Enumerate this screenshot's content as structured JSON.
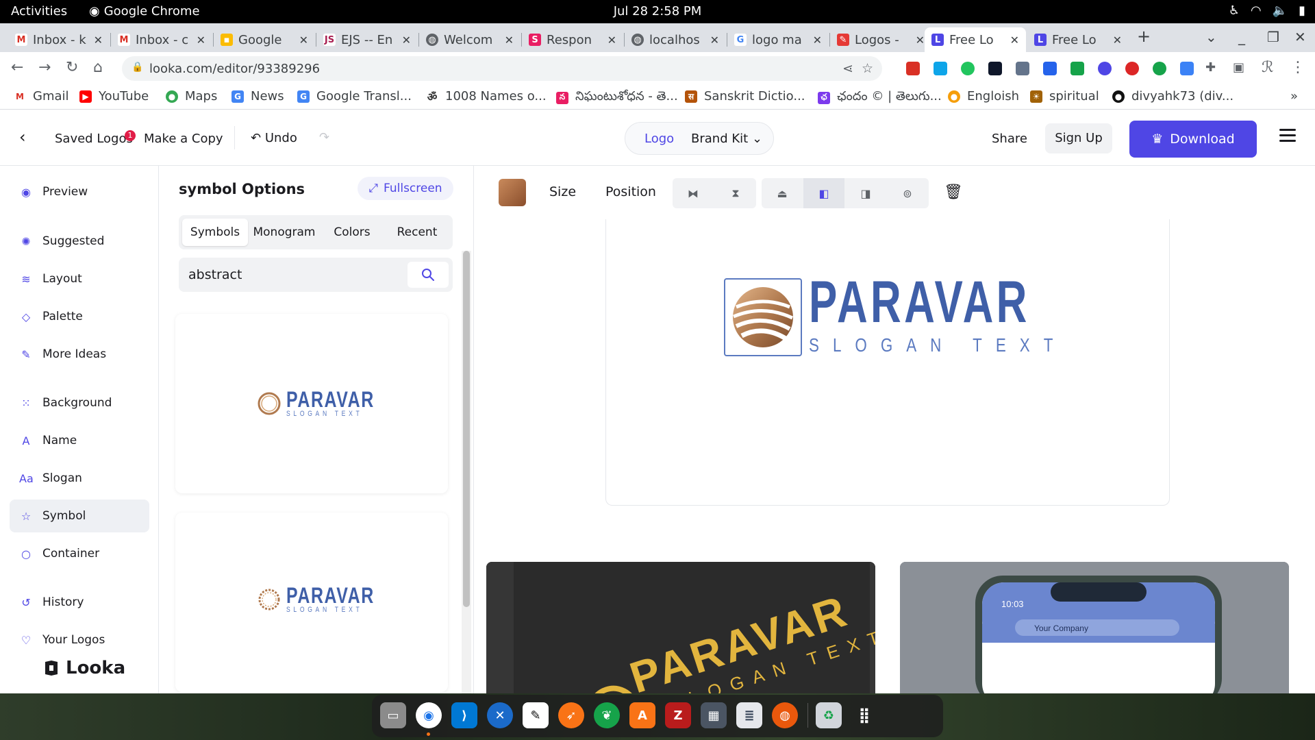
{
  "system_bar": {
    "activities": "Activities",
    "app_name": "Google Chrome",
    "clock": "Jul 28  2:58 PM"
  },
  "tabs": [
    {
      "label": "Inbox - k",
      "favicon": "gmail-icon",
      "color": "#d93025"
    },
    {
      "label": "Inbox - c",
      "favicon": "gmail-icon",
      "color": "#d93025"
    },
    {
      "label": "Google",
      "favicon": "google-keep-icon",
      "color": "#fbbc04"
    },
    {
      "label": "EJS -- En",
      "favicon": "ejs-icon",
      "color": "#a91e50"
    },
    {
      "label": "Welcom",
      "favicon": "globe-icon",
      "color": "#5f6368"
    },
    {
      "label": "Respon",
      "favicon": "responsive-icon",
      "color": "#e91e63"
    },
    {
      "label": "localhos",
      "favicon": "globe-icon",
      "color": "#5f6368"
    },
    {
      "label": "logo ma",
      "favicon": "google-icon",
      "color": "#4285f4"
    },
    {
      "label": "Logos -",
      "favicon": "logos-icon",
      "color": "#e53935"
    },
    {
      "label": "Free Lo",
      "favicon": "looka-icon",
      "color": "#4f46e5"
    },
    {
      "label": "Free Lo",
      "favicon": "looka-icon",
      "color": "#4f46e5"
    }
  ],
  "address": {
    "url": "looka.com/editor/93389296"
  },
  "bookmarks": [
    {
      "label": "Gmail",
      "color": "#d93025",
      "glyph": "M"
    },
    {
      "label": "YouTube",
      "color": "#ff0000",
      "glyph": "▶"
    },
    {
      "label": "Maps",
      "color": "#34a853",
      "glyph": "●"
    },
    {
      "label": "News",
      "color": "#4285f4",
      "glyph": "G"
    },
    {
      "label": "Google Transl...",
      "color": "#4285f4",
      "glyph": "G"
    },
    {
      "label": "1008 Names o...",
      "color": "#333333",
      "glyph": "ॐ"
    },
    {
      "label": "నిఘంటుశోధన - తె...",
      "color": "#e91e63",
      "glyph": "న"
    },
    {
      "label": "Sanskrit Dictio...",
      "color": "#b45309",
      "glyph": "स"
    },
    {
      "label": "ఛందం © | తెలుగు...",
      "color": "#7c3aed",
      "glyph": "ఛ"
    },
    {
      "label": "Engloish",
      "color": "#f59e0b",
      "glyph": "●"
    },
    {
      "label": "spiritual",
      "color": "#a16207",
      "glyph": "☀"
    },
    {
      "label": "divyahk73 (div...",
      "color": "#111111",
      "glyph": "●"
    }
  ],
  "editor": {
    "saved_logos": "Saved Logos",
    "saved_badge": "1",
    "make_copy": "Make a Copy",
    "undo": "Undo",
    "segment_logo": "Logo",
    "segment_brand_kit": "Brand Kit",
    "share": "Share",
    "sign_up": "Sign Up",
    "download": "Download",
    "accent": "#4f46e5"
  },
  "left_nav": [
    {
      "label": "Preview",
      "icon": "eye-icon",
      "glyph": "◉"
    },
    {
      "label": "Suggested",
      "icon": "lightbulb-icon",
      "glyph": "✺"
    },
    {
      "label": "Layout",
      "icon": "layers-icon",
      "glyph": "≋"
    },
    {
      "label": "Palette",
      "icon": "droplet-icon",
      "glyph": "◇"
    },
    {
      "label": "More Ideas",
      "icon": "pin-icon",
      "glyph": "✎"
    },
    {
      "label": "Background",
      "icon": "grid-icon",
      "glyph": "⁙"
    },
    {
      "label": "Name",
      "icon": "name-icon",
      "glyph": "A"
    },
    {
      "label": "Slogan",
      "icon": "slogan-icon",
      "glyph": "Aa"
    },
    {
      "label": "Symbol",
      "icon": "star-icon",
      "glyph": "☆"
    },
    {
      "label": "Container",
      "icon": "circle-icon",
      "glyph": "○"
    },
    {
      "label": "History",
      "icon": "history-icon",
      "glyph": "↺"
    },
    {
      "label": "Your Logos",
      "icon": "heart-icon",
      "glyph": "♡"
    }
  ],
  "brand": "Looka",
  "symbol_panel": {
    "title": "symbol Options",
    "fullscreen": "Fullscreen",
    "tabs": [
      "Symbols",
      "Monogram",
      "Colors",
      "Recent"
    ],
    "search_value": "abstract"
  },
  "logo": {
    "name": "PARAVAR",
    "slogan": "SLOGAN TEXT",
    "name_color": "#3f5fa8",
    "symbol_color": "#b07a4f"
  },
  "canvas_tools": {
    "size": "Size",
    "position": "Position"
  },
  "mockups": {
    "phone_time": "10:03",
    "phone_search": "Your Company"
  }
}
